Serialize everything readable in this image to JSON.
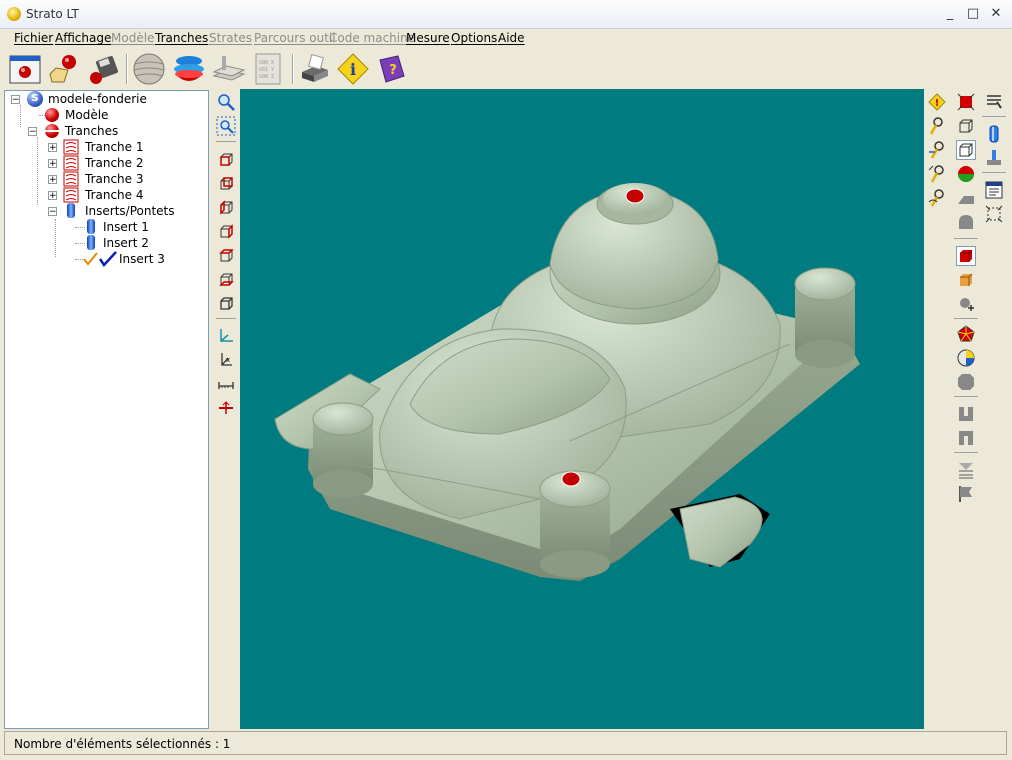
{
  "window": {
    "title": "Strato LT",
    "minimize": "_",
    "maximize": "□",
    "close": "✕"
  },
  "menu": [
    {
      "label": "Fichier",
      "enabled": true
    },
    {
      "label": "Affichage",
      "enabled": true
    },
    {
      "label": "Modèle",
      "enabled": false
    },
    {
      "label": "Tranches",
      "enabled": true
    },
    {
      "label": "Strates",
      "enabled": false
    },
    {
      "label": "Parcours outil",
      "enabled": false
    },
    {
      "label": "Code machine",
      "enabled": false
    },
    {
      "label": "Mesure",
      "enabled": true
    },
    {
      "label": "Options",
      "enabled": true
    },
    {
      "label": "Aide",
      "enabled": true
    }
  ],
  "toolbar": {
    "icons": [
      "new-project-icon",
      "open-model-icon",
      "save-icon",
      "model-sphere-icon",
      "slices-icon",
      "layers-icon",
      "gcode-icon",
      "print-icon",
      "info-icon",
      "help-book-icon"
    ],
    "gcode_text": "G00 X\nG01 Y\nG00 Z"
  },
  "tree": {
    "root": "modele-fonderie",
    "model": "Modèle",
    "slices": "Tranches",
    "slice_items": [
      "Tranche 1",
      "Tranche 2",
      "Tranche 3",
      "Tranche 4"
    ],
    "inserts": "Inserts/Pontets",
    "insert_items": [
      "Insert 1",
      "Insert 2",
      "Insert 3"
    ]
  },
  "status": {
    "text": "Nombre d'éléments sélectionnés : 1"
  },
  "colors": {
    "viewport": "#007c80",
    "part": "#b7c7b0",
    "marker": "#c40000"
  },
  "left_tools": [
    "zoom-window-icon",
    "zoom-fit-icon",
    "view-front-icon",
    "view-back-icon",
    "view-left-icon",
    "view-right-icon",
    "view-top-icon",
    "view-bottom-icon",
    "view-iso-icon",
    "axes-icon",
    "axes-3d-icon",
    "measure-icon",
    "section-icon"
  ],
  "right_tools_col1": [
    "warning-icon",
    "pin-icon",
    "pin-move-icon",
    "pin-edit-icon",
    "pin-route-icon"
  ],
  "right_tools_col2": [
    "select-red-icon",
    "wire-cube-icon",
    "hidden-cube-icon",
    "shaded-sphere-icon",
    "fill-shape-icon",
    "bell-shape-icon",
    "red-cube-icon",
    "orange-cube-icon",
    "rotate-icon",
    "red-polyhedron-icon",
    "pie-icon",
    "octagon-icon",
    "step-icon",
    "step-alt-icon",
    "ladder-icon",
    "flag-icon"
  ],
  "right_tools_col3": [
    "probe-icon",
    "insert-cylinder-icon",
    "clamp-icon",
    "report-icon",
    "bbox-icon"
  ]
}
